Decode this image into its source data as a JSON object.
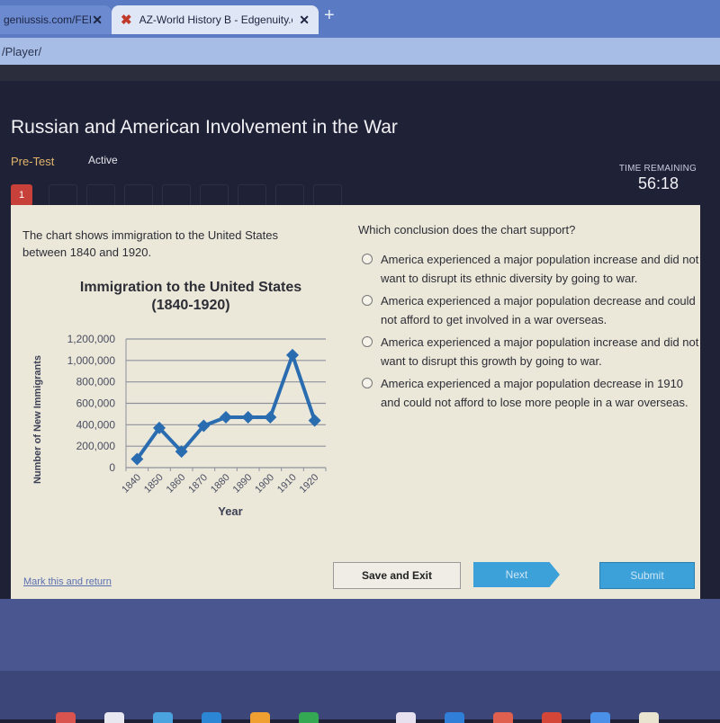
{
  "browser": {
    "tabs": [
      {
        "label": "geniussis.com/FEI",
        "active": false
      },
      {
        "label": "AZ-World History B - Edgenuity.cc",
        "active": true
      }
    ],
    "url": "/Player/"
  },
  "header": {
    "title": "Russian and American Involvement in the War",
    "mode": "Pre-Test",
    "status": "Active",
    "question_number": "1",
    "time_label": "TIME REMAINING",
    "time_value": "56:18"
  },
  "content": {
    "prompt": "The chart shows immigration to the United States between 1840 and 1920.",
    "question": "Which conclusion does the chart support?",
    "options": [
      "America experienced a major population increase and did not want to disrupt its ethnic diversity by going to war.",
      "America experienced a major population decrease and could not afford to get involved in a war overseas.",
      "America experienced a major population increase and did not want to disrupt this growth by going to war.",
      "America experienced a major population decrease in 1910 and could not afford to lose more people in a war overseas."
    ]
  },
  "chart_data": {
    "type": "line",
    "title": "Immigration to the United States (1840-1920)",
    "xlabel": "Year",
    "ylabel": "Number of New Immigrants",
    "categories": [
      "1840",
      "1850",
      "1860",
      "1870",
      "1880",
      "1890",
      "1900",
      "1910",
      "1920"
    ],
    "series": [
      {
        "name": "New Immigrants",
        "values": [
          80000,
          370000,
          150000,
          390000,
          470000,
          470000,
          470000,
          1050000,
          440000
        ]
      }
    ],
    "ylim": [
      0,
      1200000
    ],
    "yticks": [
      "0",
      "200,000",
      "400,000",
      "600,000",
      "800,000",
      "1,000,000",
      "1,200,000"
    ],
    "grid": true,
    "color": "#2a6cb0"
  },
  "footer": {
    "mark_link": "Mark this and return",
    "save_exit": "Save and Exit",
    "next": "Next",
    "submit": "Submit"
  }
}
